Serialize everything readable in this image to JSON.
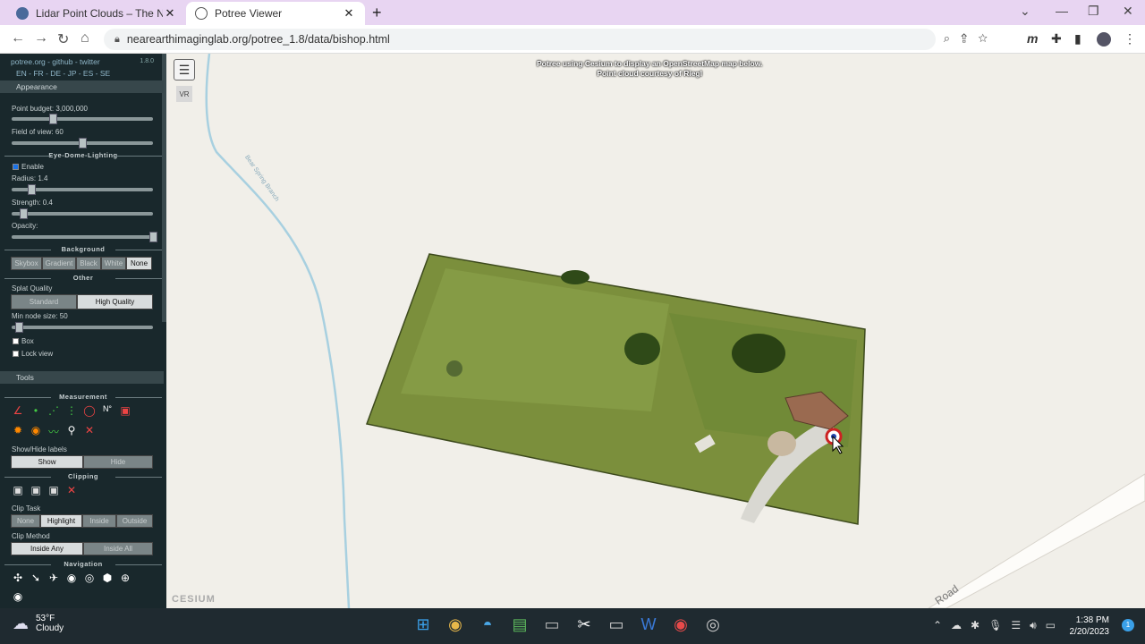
{
  "browser": {
    "tabs": [
      {
        "title": "Lidar Point Clouds – The Near Ear",
        "active": false
      },
      {
        "title": "Potree Viewer",
        "active": true
      }
    ],
    "url": "nearearthimaginglab.org/potree_1.8/data/bishop.html"
  },
  "sidebar": {
    "links": "potree.org - github - twitter",
    "version": "1.8.0",
    "languages": "EN - FR - DE - JP - ES - SE",
    "appearance": {
      "header": "Appearance",
      "point_budget_label": "Point budget: 3,000,000",
      "point_budget_level": 0.3,
      "fov_label": "Field of view: 60",
      "fov_level": 0.5,
      "edl_header": "Eye-Dome-Lighting",
      "edl_enable": "Enable",
      "radius_label": "Radius: 1.4",
      "radius_level": 0.14,
      "strength_label": "Strength: 0.4",
      "strength_level": 0.08,
      "opacity_label": "Opacity:",
      "opacity_level": 1.0,
      "background_header": "Background",
      "background_options": [
        "Skybox",
        "Gradient",
        "Black",
        "White",
        "None"
      ],
      "background_selected": "None",
      "other_header": "Other",
      "splat_label": "Splat Quality",
      "splat_options": [
        "Standard",
        "High Quality"
      ],
      "splat_selected": "High Quality",
      "min_node_label": "Min node size: 50",
      "min_node_level": 0.02,
      "box_label": "Box",
      "lock_view_label": "Lock view"
    },
    "tools": {
      "header": "Tools",
      "measurement_header": "Measurement",
      "show_hide_label": "Show/Hide labels",
      "show_hide_options": [
        "Show",
        "Hide"
      ],
      "clipping_header": "Clipping",
      "clip_task_label": "Clip Task",
      "clip_task_options": [
        "None",
        "Highlight",
        "Inside",
        "Outside"
      ],
      "clip_task_selected": "Highlight",
      "clip_method_label": "Clip Method",
      "clip_method_options": [
        "Inside Any",
        "Inside All"
      ],
      "clip_method_selected": "Inside Any",
      "navigation_header": "Navigation"
    }
  },
  "viewer": {
    "attribution_line1": "Potree using Cesium to display an OpenStreetMap map below.",
    "attribution_line2": "Point cloud courtesy of Riegl",
    "vr_label": "VR",
    "cesium_logo": "CESIUM",
    "road_label": "Road",
    "stream_label": "Bear Spring Branch"
  },
  "taskbar": {
    "temperature": "53°F",
    "weather": "Cloudy",
    "time": "1:38 PM",
    "date": "2/20/2023"
  }
}
